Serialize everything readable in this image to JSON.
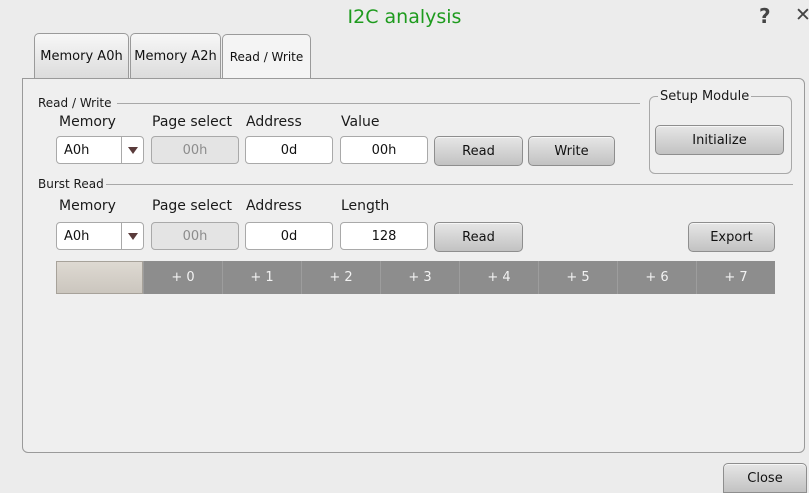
{
  "window": {
    "title": "I2C analysis"
  },
  "header_icons": [
    "help-icon",
    "tools-icon"
  ],
  "tabs": [
    {
      "label": "Memory A0h",
      "active": false
    },
    {
      "label": "Memory A2h",
      "active": false
    },
    {
      "label": "Read / Write",
      "active": true
    }
  ],
  "read_write": {
    "group_label": "Read / Write",
    "labels": {
      "memory": "Memory",
      "page_select": "Page select",
      "address": "Address",
      "value": "Value"
    },
    "memory_selected": "A0h",
    "page_select_value": "00h",
    "address_value": "0d",
    "value_value": "00h",
    "read_button": "Read",
    "write_button": "Write"
  },
  "setup_module": {
    "group_label": "Setup Module",
    "initialize_button": "Initialize"
  },
  "burst_read": {
    "group_label": "Burst Read",
    "labels": {
      "memory": "Memory",
      "page_select": "Page select",
      "address": "Address",
      "length": "Length"
    },
    "memory_selected": "A0h",
    "page_select_value": "00h",
    "address_value": "0d",
    "length_value": "128",
    "read_button": "Read",
    "export_button": "Export",
    "columns": [
      "+ 0",
      "+ 1",
      "+ 2",
      "+ 3",
      "+ 4",
      "+ 5",
      "+ 6",
      "+ 7"
    ]
  },
  "footer": {
    "close_button": "Close"
  },
  "colors": {
    "title": "#1e9b1e",
    "column_header_bg": "#8d8d8d",
    "corner_bg": "#d6d1ca"
  }
}
